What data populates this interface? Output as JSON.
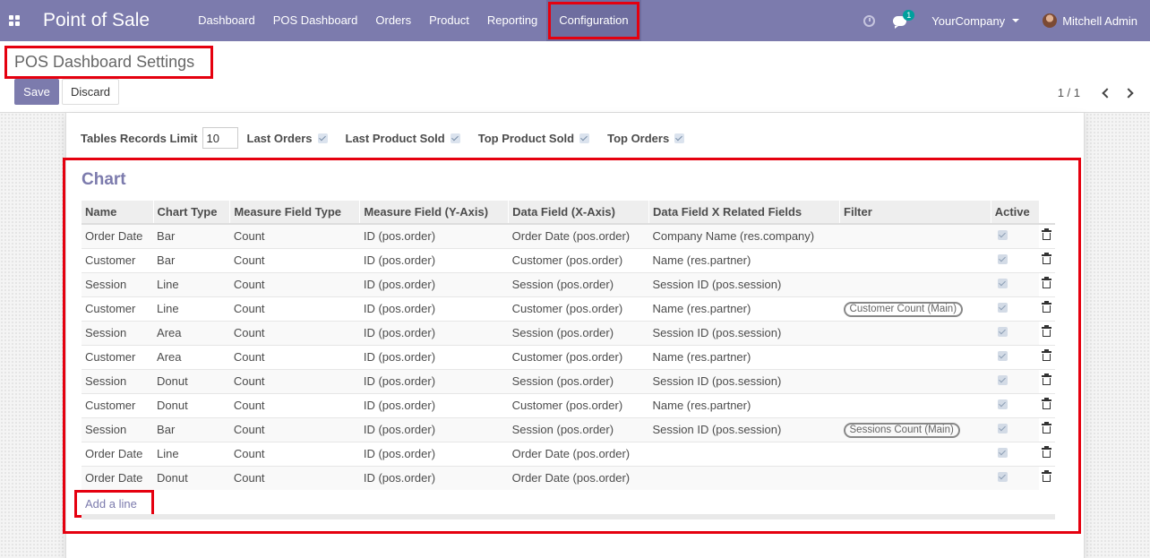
{
  "navbar": {
    "brand": "Point of Sale",
    "menu": [
      "Dashboard",
      "POS Dashboard",
      "Orders",
      "Product",
      "Reporting",
      "Configuration"
    ],
    "active_menu": "Configuration",
    "message_count": "1",
    "company": "YourCompany",
    "user": "Mitchell Admin"
  },
  "control_panel": {
    "title": "POS Dashboard Settings",
    "save_label": "Save",
    "discard_label": "Discard",
    "pager": "1 / 1"
  },
  "settings": {
    "records_limit_label": "Tables Records Limit",
    "records_limit_value": "10",
    "last_orders_label": "Last Orders",
    "last_product_sold_label": "Last Product Sold",
    "top_product_sold_label": "Top Product Sold",
    "top_orders_label": "Top Orders"
  },
  "chart": {
    "title": "Chart",
    "columns": [
      "Name",
      "Chart Type",
      "Measure Field Type",
      "Measure Field (Y-Axis)",
      "Data Field (X-Axis)",
      "Data Field X Related Fields",
      "Filter",
      "Active"
    ],
    "rows": [
      {
        "name": "Order Date",
        "type": "Bar",
        "measure_type": "Count",
        "measure": "ID (pos.order)",
        "data_field": "Order Date (pos.order)",
        "related": "Company Name (res.company)",
        "filter": ""
      },
      {
        "name": "Customer",
        "type": "Bar",
        "measure_type": "Count",
        "measure": "ID (pos.order)",
        "data_field": "Customer (pos.order)",
        "related": "Name (res.partner)",
        "filter": ""
      },
      {
        "name": "Session",
        "type": "Line",
        "measure_type": "Count",
        "measure": "ID (pos.order)",
        "data_field": "Session (pos.order)",
        "related": "Session ID (pos.session)",
        "filter": ""
      },
      {
        "name": "Customer",
        "type": "Line",
        "measure_type": "Count",
        "measure": "ID (pos.order)",
        "data_field": "Customer (pos.order)",
        "related": "Name (res.partner)",
        "filter": "Customer Count (Main)"
      },
      {
        "name": "Session",
        "type": "Area",
        "measure_type": "Count",
        "measure": "ID (pos.order)",
        "data_field": "Session (pos.order)",
        "related": "Session ID (pos.session)",
        "filter": ""
      },
      {
        "name": "Customer",
        "type": "Area",
        "measure_type": "Count",
        "measure": "ID (pos.order)",
        "data_field": "Customer (pos.order)",
        "related": "Name (res.partner)",
        "filter": ""
      },
      {
        "name": "Session",
        "type": "Donut",
        "measure_type": "Count",
        "measure": "ID (pos.order)",
        "data_field": "Session (pos.order)",
        "related": "Session ID (pos.session)",
        "filter": ""
      },
      {
        "name": "Customer",
        "type": "Donut",
        "measure_type": "Count",
        "measure": "ID (pos.order)",
        "data_field": "Customer (pos.order)",
        "related": "Name (res.partner)",
        "filter": ""
      },
      {
        "name": "Session",
        "type": "Bar",
        "measure_type": "Count",
        "measure": "ID (pos.order)",
        "data_field": "Session (pos.order)",
        "related": "Session ID (pos.session)",
        "filter": "Sessions Count (Main)"
      },
      {
        "name": "Order Date",
        "type": "Line",
        "measure_type": "Count",
        "measure": "ID (pos.order)",
        "data_field": "Order Date (pos.order)",
        "related": "",
        "filter": ""
      },
      {
        "name": "Order Date",
        "type": "Donut",
        "measure_type": "Count",
        "measure": "ID (pos.order)",
        "data_field": "Order Date (pos.order)",
        "related": "",
        "filter": ""
      }
    ],
    "add_line_label": "Add a line"
  },
  "colors": {
    "brand": "#7c7bad",
    "highlight": "#e5000f"
  }
}
